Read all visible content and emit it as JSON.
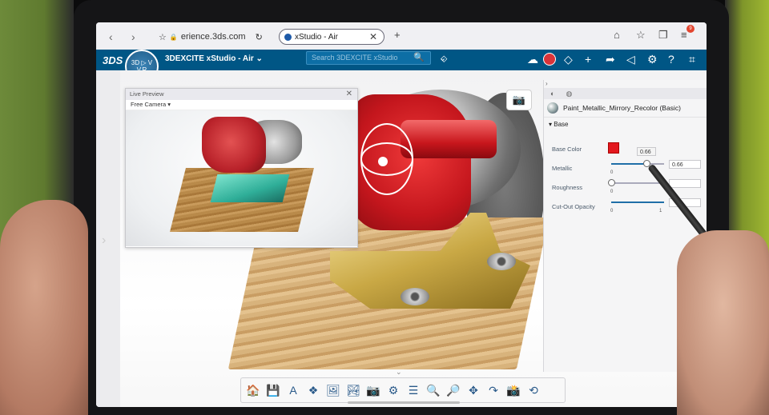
{
  "browser": {
    "url": "erience.3ds.com",
    "tab_title": "xStudio - Air",
    "tab_close": "✕",
    "new_tab": "+",
    "back": "‹",
    "forward": "›",
    "reload": "↻",
    "star": "☆",
    "lock": "🔒",
    "home": "⌂",
    "bookmark": "☆",
    "tabs_icon": "❐",
    "menu": "≡",
    "notif_count": "9"
  },
  "app": {
    "brand": "3DS",
    "compass_label": "3D ▷ V\nV.R",
    "title": "3DEXCITE xStudio - Air ⌄",
    "search_placeholder": "Search 3DEXCITE xStudio",
    "search_icon": "🔍",
    "header_icons": [
      "☁",
      "◇",
      "+",
      "➦",
      "◁",
      "⚙",
      "?",
      "⌗"
    ]
  },
  "live_preview": {
    "title": "Live Preview",
    "close": "✕",
    "camera": "Free Camera ▾"
  },
  "panel": {
    "collapse": "›",
    "tabs": [
      "◐",
      "◍"
    ],
    "material_name": "Paint_Metallic_Mirrory_Recolor (Basic)",
    "section": "▾  Base",
    "rows": {
      "base_color": "Base Color",
      "metallic": "Metallic",
      "roughness": "Roughness",
      "cutout": "Cut-Out Opacity"
    },
    "base_color_hex": "#e3181e",
    "metallic_value": "0.66",
    "metallic_tooltip": "0.66",
    "metallic_fraction": 0.66,
    "roughness_fraction": 0.0,
    "cutout_fraction": 1.0,
    "tick_min": "0",
    "tick_max": "1"
  },
  "toolbar": {
    "items": [
      "🏠",
      "💾",
      "A",
      "❖",
      "🖼",
      "🏞",
      "📷",
      "⚙",
      "☰",
      "🔍",
      "🔎",
      "✥",
      "↷",
      "📸",
      "⟲"
    ]
  },
  "viewport": {
    "camera_icon": "📷",
    "edge_arrow": "›",
    "collapse_caret": "⌄"
  }
}
